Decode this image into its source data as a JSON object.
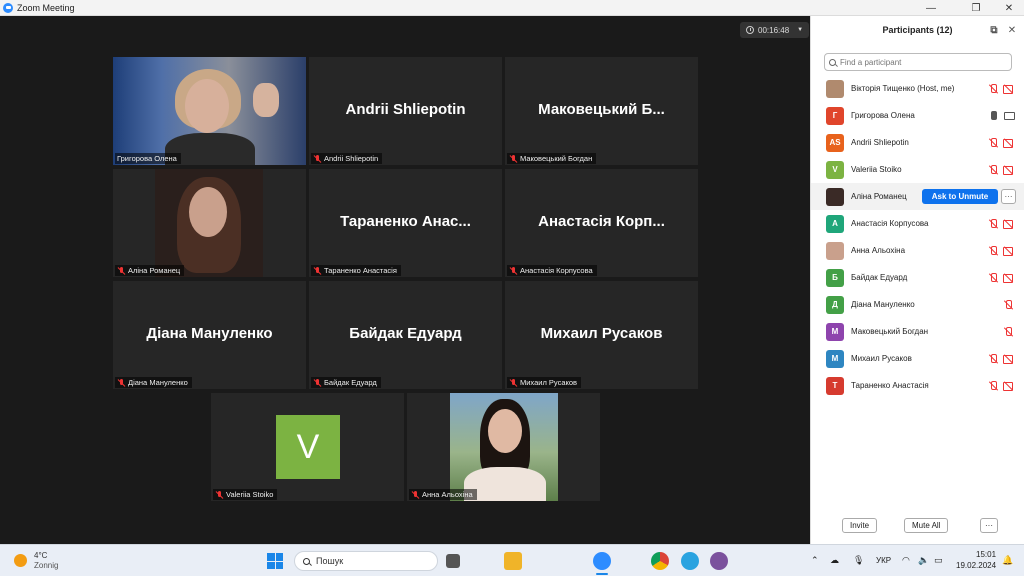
{
  "window": {
    "title": "Zoom Meeting"
  },
  "meeting": {
    "timer": "00:16:48",
    "tiles": [
      {
        "display_name": "",
        "label": "Григорова Олена",
        "video": true
      },
      {
        "display_name": "Andrii Shliepotin",
        "label": "Andrii Shliepotin",
        "video": false
      },
      {
        "display_name": "Маковецький Б...",
        "label": "Маковецький Богдан",
        "video": false
      },
      {
        "display_name": "",
        "label": "Аліна Романец",
        "video": true
      },
      {
        "display_name": "Тараненко Анас...",
        "label": "Тараненко Анастасія",
        "video": false
      },
      {
        "display_name": "Анастасія Корп...",
        "label": "Анастасія Корпусова",
        "video": false
      },
      {
        "display_name": "Діана Мануленко",
        "label": "Діана Мануленко",
        "video": false
      },
      {
        "display_name": "Байдак Едуард",
        "label": "Байдак Едуард",
        "video": false
      },
      {
        "display_name": "Михаил Русаков",
        "label": "Михаил Русаков",
        "video": false
      },
      {
        "display_name": "V",
        "label": "Valeriia Stoiko",
        "video": false
      },
      {
        "display_name": "",
        "label": "Анна Альохіна",
        "video": true
      }
    ]
  },
  "participants": {
    "title": "Participants (12)",
    "search_placeholder": "Find a participant",
    "list": [
      {
        "name": "Вікторія Тищенко (Host, me)",
        "avatar": "",
        "color": "#b08a6e",
        "photo": true
      },
      {
        "name": "Григорова Олена",
        "avatar": "Г",
        "color": "#e0452b",
        "mic_on": true
      },
      {
        "name": "Andrii Shliepotin",
        "avatar": "AS",
        "color": "#e8621c"
      },
      {
        "name": "Valeriia Stoiko",
        "avatar": "V",
        "color": "#7cb342"
      },
      {
        "name": "Аліна Романец",
        "avatar": "",
        "color": "#3a2a26",
        "photo": true
      },
      {
        "name": "Анастасія Корпусова",
        "avatar": "А",
        "color": "#1fa67a"
      },
      {
        "name": "Анна Альохіна",
        "avatar": "",
        "color": "#c9a08c",
        "photo": true
      },
      {
        "name": "Байдак Едуард",
        "avatar": "Б",
        "color": "#43a047"
      },
      {
        "name": "Діана Мануленко",
        "avatar": "Д",
        "color": "#43a047"
      },
      {
        "name": "Маковецький Богдан",
        "avatar": "М",
        "color": "#8e44ad"
      },
      {
        "name": "Михаил Русаков",
        "avatar": "М",
        "color": "#2e86c1"
      },
      {
        "name": "Тараненко Анастасія",
        "avatar": "Т",
        "color": "#d63b2f"
      }
    ],
    "ask_to_unmute": "Ask to Unmute",
    "more": "···",
    "invite": "Invite",
    "mute_all": "Mute All"
  },
  "taskbar": {
    "weather_temp": "4°C",
    "weather_desc": "Zonnig",
    "search_label": "Пошук",
    "language": "УКР",
    "time": "15:01",
    "date": "19.02.2024"
  }
}
